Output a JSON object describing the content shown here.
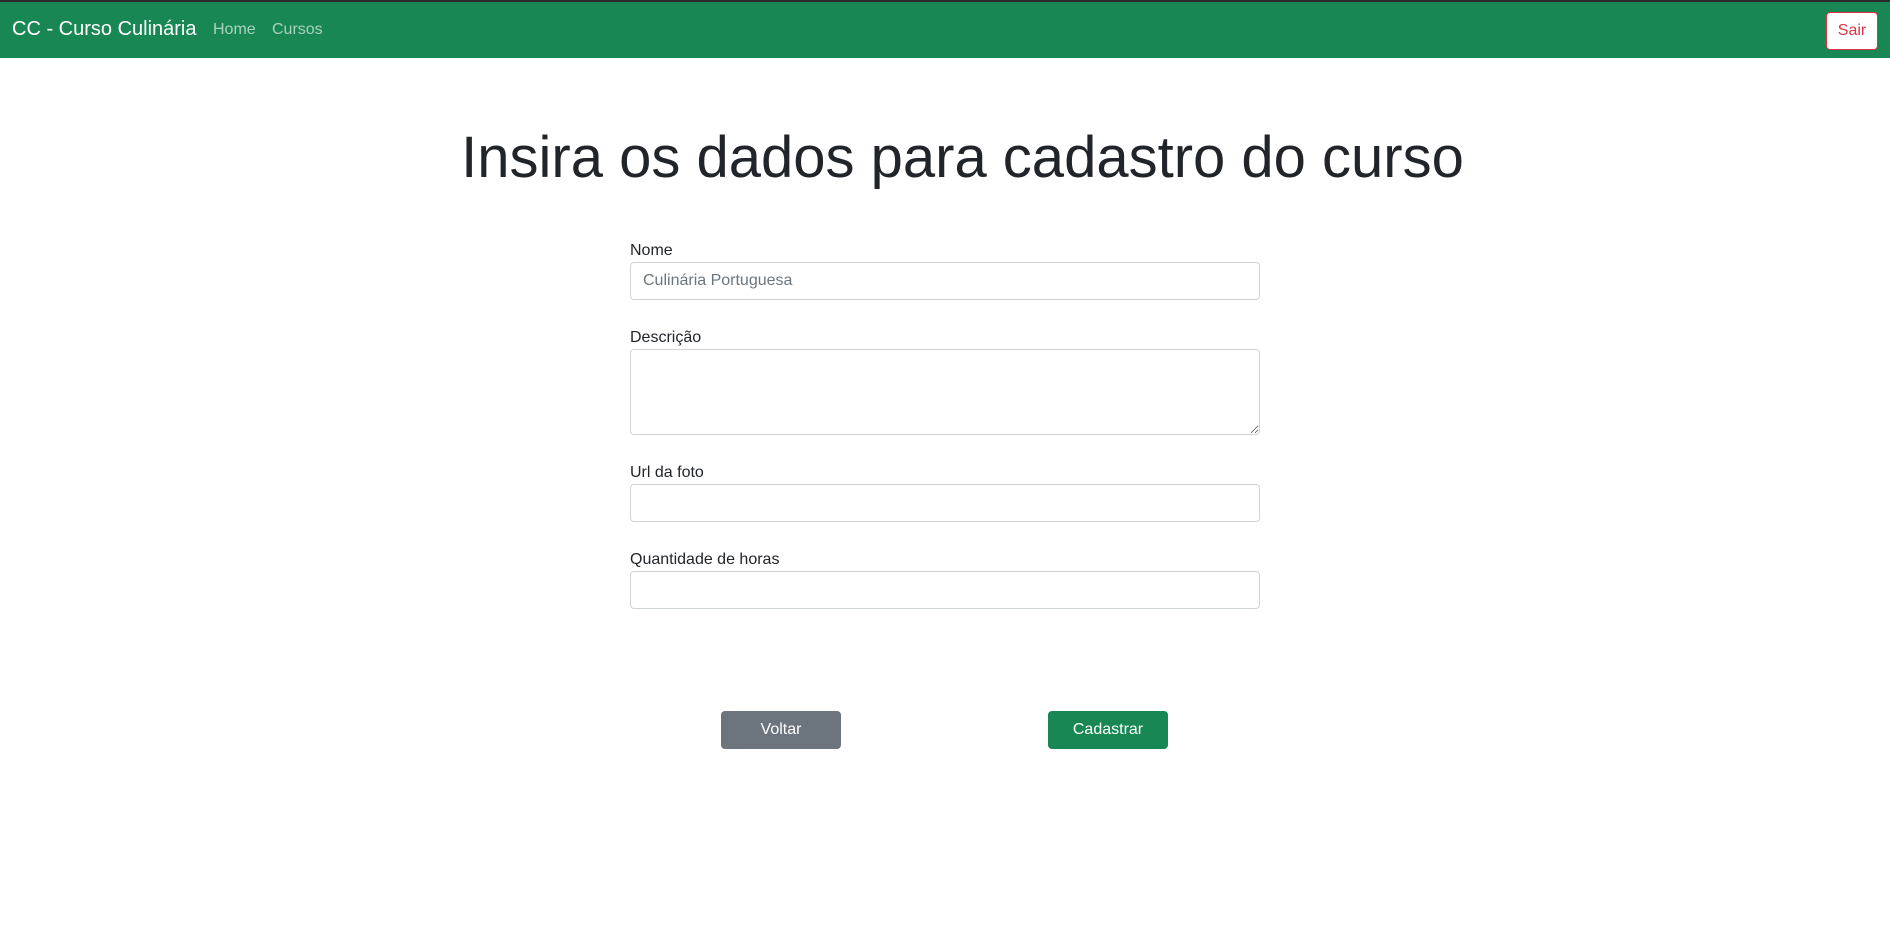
{
  "navbar": {
    "brand": "CC - Curso Culinária",
    "links": [
      {
        "label": "Home"
      },
      {
        "label": "Cursos"
      }
    ],
    "logout_label": "Sair"
  },
  "page": {
    "title": "Insira os dados para cadastro do curso"
  },
  "form": {
    "nome": {
      "label": "Nome",
      "placeholder": "Culinária Portuguesa",
      "value": ""
    },
    "descricao": {
      "label": "Descrição",
      "placeholder": "",
      "value": ""
    },
    "url_foto": {
      "label": "Url da foto",
      "placeholder": "",
      "value": ""
    },
    "horas": {
      "label": "Quantidade de horas",
      "placeholder": "",
      "value": ""
    }
  },
  "actions": {
    "back_label": "Voltar",
    "submit_label": "Cadastrar"
  },
  "colors": {
    "navbar_bg": "#198754",
    "logout": "#dc3545",
    "back_button": "#6c757d",
    "submit_button": "#198754"
  }
}
